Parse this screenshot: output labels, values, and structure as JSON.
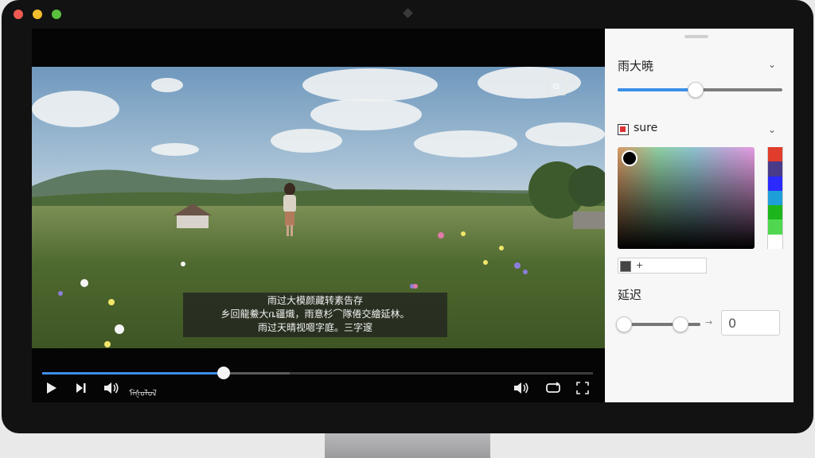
{
  "subtitles": [
    "雨过大模颜藏转素告存",
    "乡回龍鯗大ቤ疆熾，雨意杉⌒隊倦交繪延林。",
    "雨过天晴视嗯字庭。三字邃"
  ],
  "player": {
    "progress": 0.33,
    "buffered": 0.45,
    "time_text": "ᠮᡝᡧᠣᠯᠣᠯ"
  },
  "panel": {
    "size_label": "雨大暁",
    "size_value": 0.47,
    "color_label": "sure",
    "swatches": [
      "#e13c2c",
      "#4a3a8a",
      "#2a2aff",
      "#1f9fd9",
      "#1cb51c",
      "#4fd84f",
      "#ffffff"
    ],
    "hex_value": "+",
    "delay_label": "延迟",
    "delay_value": "0",
    "delay_range": [
      0.0,
      0.64
    ]
  },
  "colors": {
    "accent": "#3b8fe6",
    "panel_bg": "#f7f7f7",
    "bezel": "#121213"
  },
  "icons": {
    "play": "play-icon",
    "next": "skip-next-icon",
    "volume": "volume-icon",
    "volume_right": "volume-icon",
    "loop": "loop-icon",
    "fullscreen": "fullscreen-icon",
    "pip": "picture-in-picture-icon",
    "chevron": "chevron-down-icon",
    "color": "color-swatch-icon"
  }
}
